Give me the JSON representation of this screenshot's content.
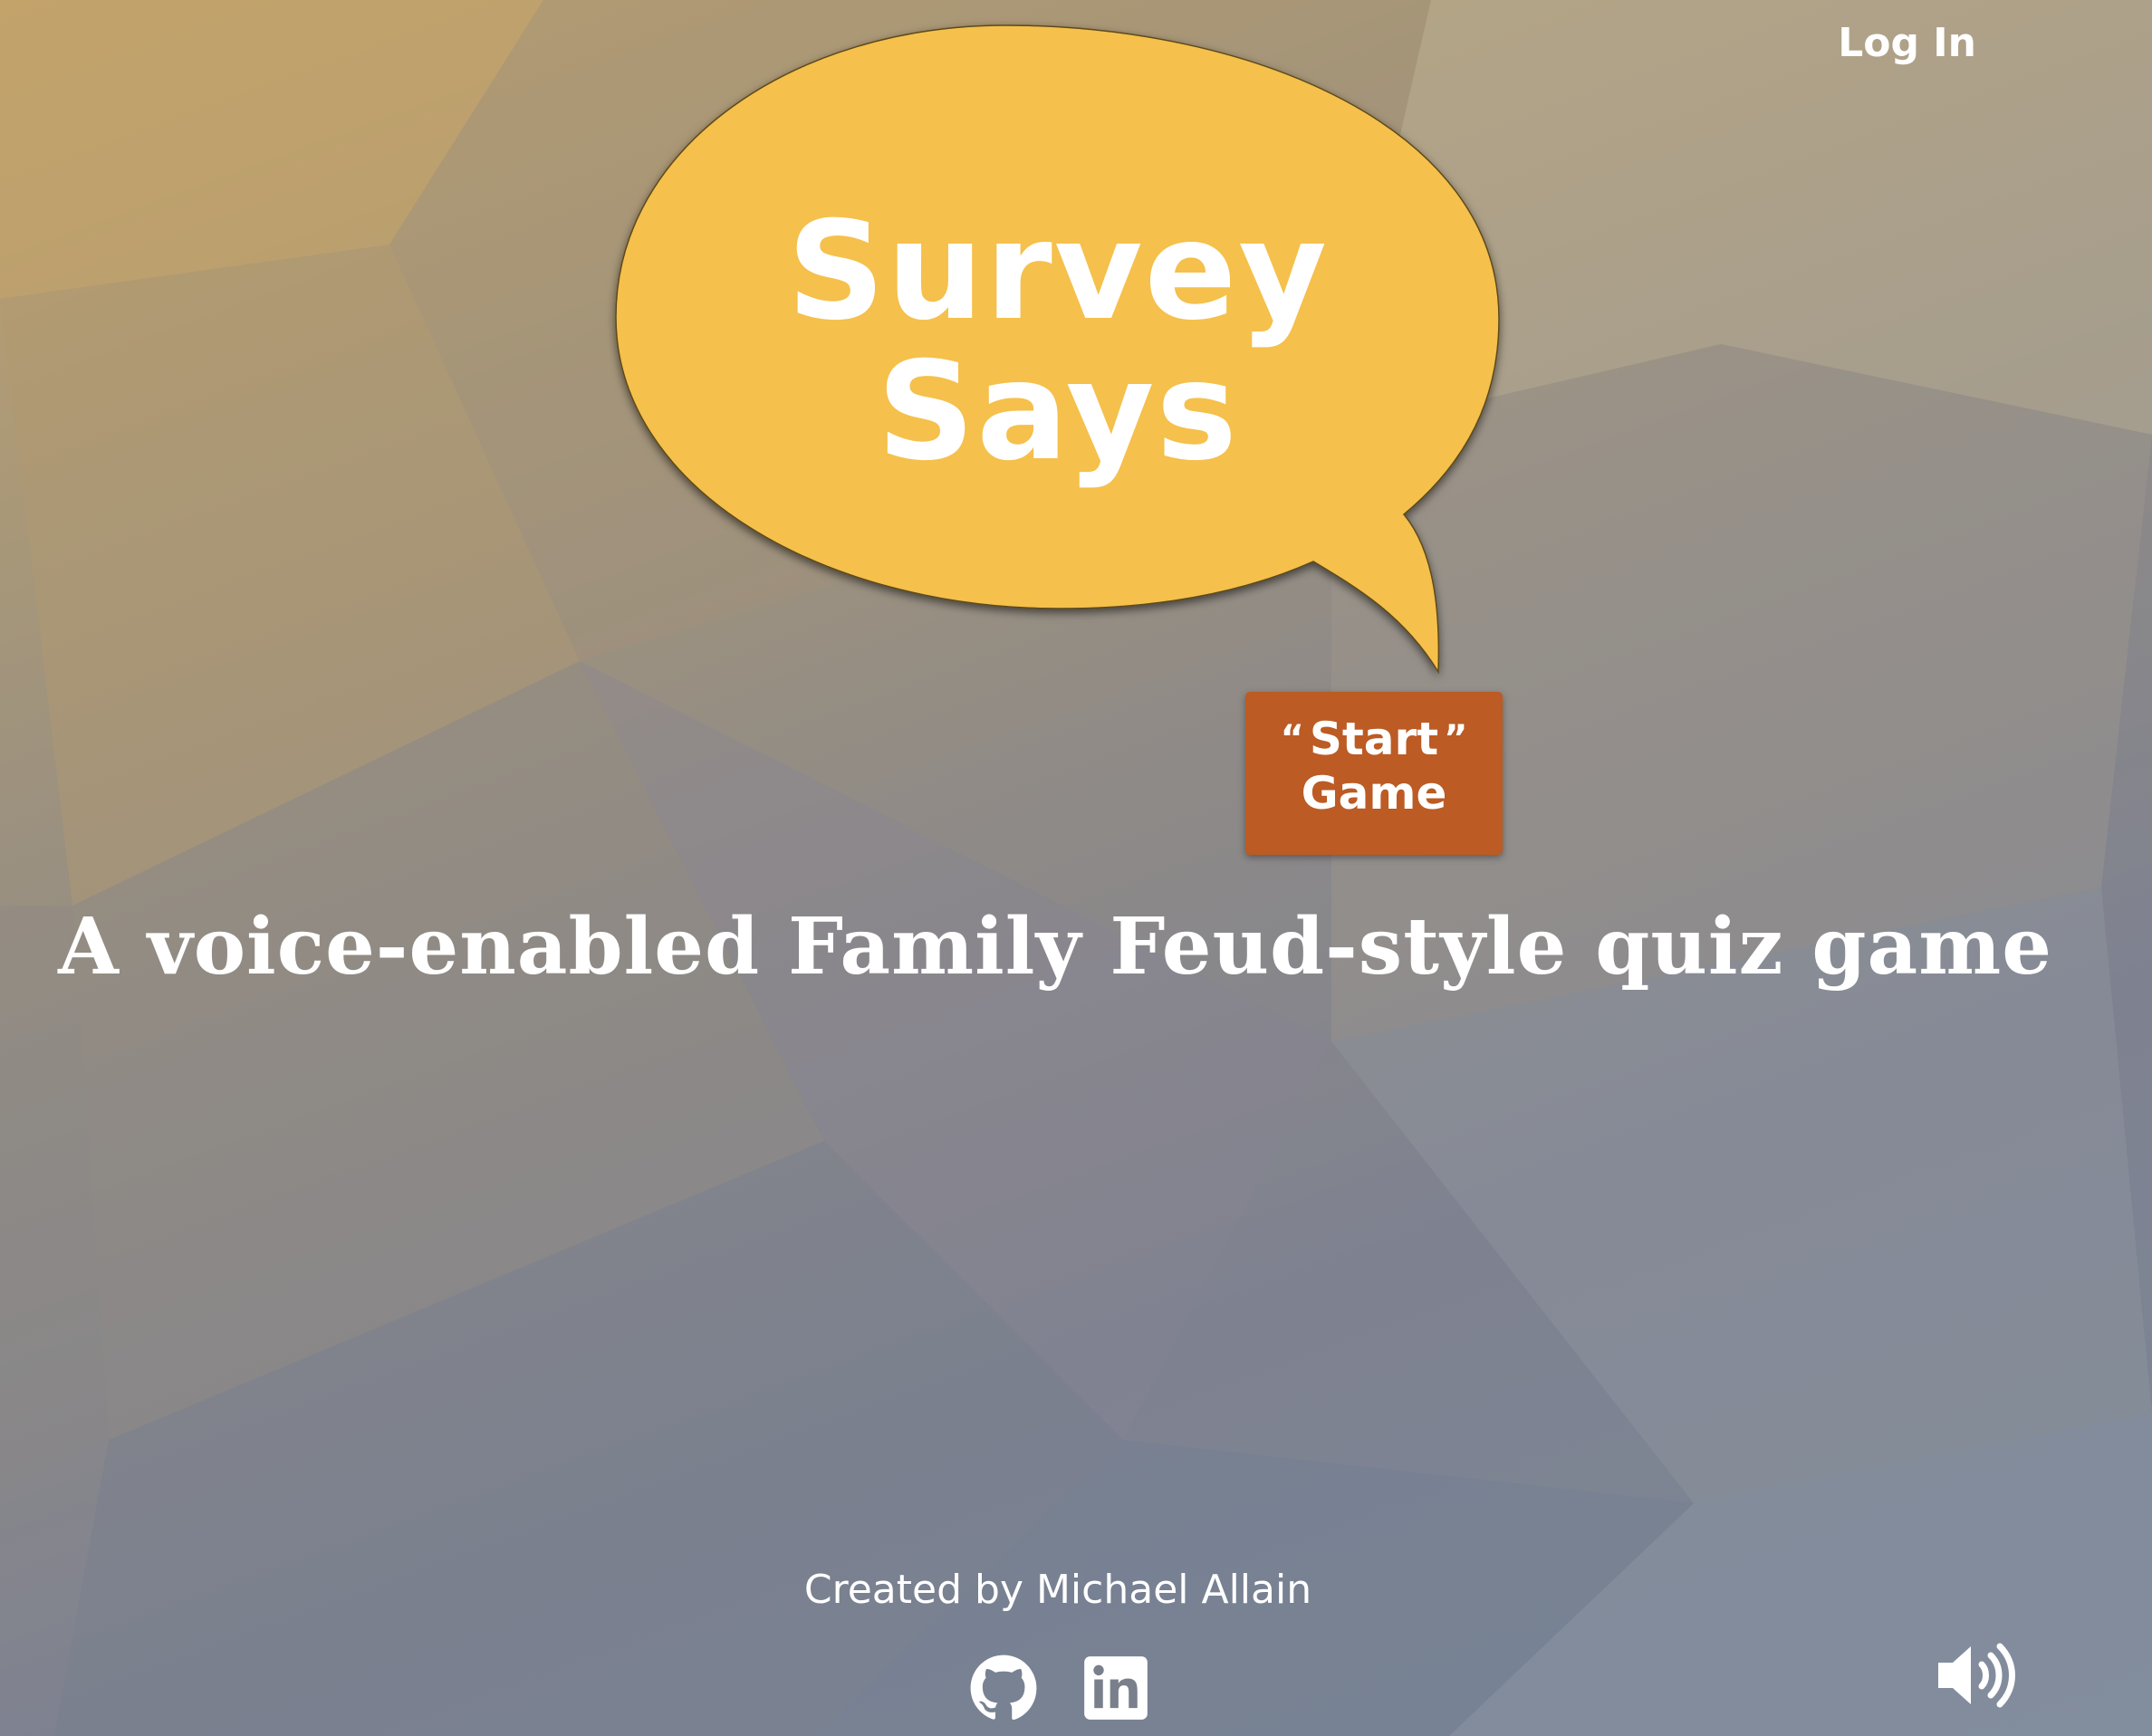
{
  "header": {
    "login_label": "Log In"
  },
  "logo": {
    "line1": "Survey",
    "line2": "Says",
    "bubble_color": "#f5c04c"
  },
  "start_button": {
    "open_quote": "“",
    "word1": "Start",
    "close_quote": "”",
    "word2": "Game",
    "color": "#bc5b24"
  },
  "tagline": "A voice-enabled Family Feud-style quiz game",
  "footer": {
    "credit": "Created by Michael Allain",
    "links": [
      {
        "icon": "github-icon"
      },
      {
        "icon": "linkedin-icon"
      }
    ],
    "sound_icon": "speaker-volume-icon"
  }
}
